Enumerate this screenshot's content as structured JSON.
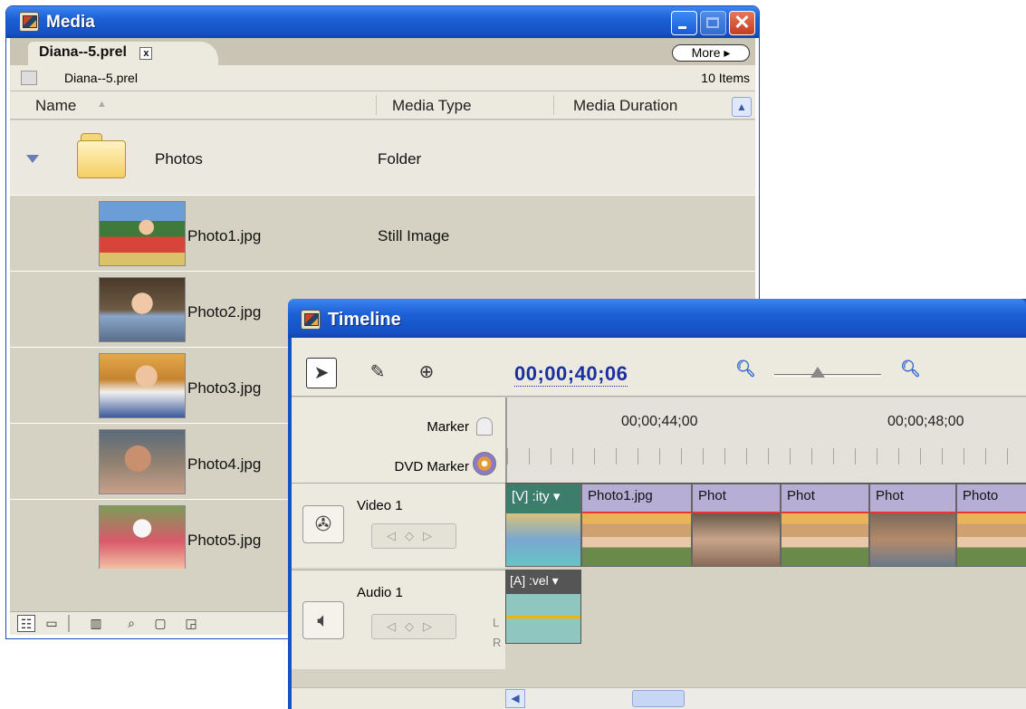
{
  "media": {
    "title": "Media",
    "tab_label": "Diana--5.prel",
    "tab_close": "x",
    "more_label": "More ▸",
    "path": "Diana--5.prel",
    "item_count": "10 Items",
    "columns": {
      "name": "Name",
      "type": "Media Type",
      "duration": "Media Duration"
    },
    "folder": {
      "name": "Photos",
      "type": "Folder"
    },
    "items": [
      {
        "name": "Photo1.jpg",
        "type": "Still Image"
      },
      {
        "name": "Photo2.jpg",
        "type": ""
      },
      {
        "name": "Photo3.jpg",
        "type": ""
      },
      {
        "name": "Photo4.jpg",
        "type": ""
      },
      {
        "name": "Photo5.jpg",
        "type": ""
      }
    ]
  },
  "timeline": {
    "title": "Timeline",
    "timecode": "00;00;40;06",
    "marker_label": "Marker",
    "dvd_marker_label": "DVD Marker",
    "ruler_times": [
      "00;00;44;00",
      "00;00;48;00"
    ],
    "video_track": "Video 1",
    "audio_track": "Audio 1",
    "video_clips": [
      "[V] :ity ▾",
      "Photo1.jpg",
      "Phot",
      "Phot",
      "Phot",
      "Photo"
    ],
    "audio_clip": "[A] :vel ▾",
    "lr": [
      "L",
      "R"
    ]
  },
  "colors": {
    "titlebar": "#1552c4",
    "accent": "#1a2fa0",
    "clip": "#b7aed6"
  }
}
